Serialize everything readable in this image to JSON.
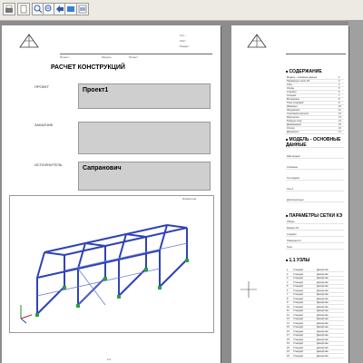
{
  "toolbar": {
    "icons": [
      "print-icon",
      "page-setup-icon",
      "zoom-in-icon",
      "zoom-out-icon",
      "navigate-icon",
      "export-icon",
      "settings-icon"
    ]
  },
  "page1": {
    "header_small": [
      "Стр.:",
      "Лист:",
      "Раздел:",
      "Проект:",
      "Модель:"
    ],
    "header_sub": [
      "Проект:",
      "Модель:",
      "Проект"
    ],
    "title": "РАСЧЕТ КОНСТРУКЦИЙ",
    "fields": [
      {
        "label": "ПРОЕКТ",
        "value": "Проект1"
      },
      {
        "label": "ЗАКАЗЧИК",
        "value": ""
      },
      {
        "label": "ИСПОЛНИТЕЛЬ",
        "value": "Сапранович"
      }
    ],
    "figure_caption": "Изометрия",
    "page_number": "1/1"
  },
  "page2": {
    "toc_title": "СОДЕРЖАНИЕ",
    "model_title": "МОДЕЛЬ - ОСНОВНЫЕ ДАННЫЕ",
    "mesh_title": "ПАРАМЕТРЫ СЕТКИ КЭ",
    "nodes_title": "1.1 УЗЛЫ",
    "toc_items": [
      "Модель - основные данные",
      "Параметры сетки КЭ",
      "Узлы",
      "Опоры",
      "Стержни",
      "Сечения",
      "Материалы",
      "Типы стержней",
      "Шарниры",
      "Загружения",
      "Сочетания нагрузок",
      "Результаты",
      "Реакции опор",
      "Деформации",
      "Усилия",
      "Документы"
    ],
    "model_rows": [
      "Общие",
      "Имя модели",
      "Описание",
      "Тип модели",
      "Ось Z",
      "Дополнительно"
    ],
    "mesh_rows": [
      "Общие",
      "Размер КЭ",
      "Стержни",
      "Поверхности",
      "Тела"
    ],
    "node_rows": [
      "1",
      "2",
      "3",
      "4",
      "5",
      "6",
      "7",
      "8",
      "9",
      "10",
      "11",
      "12",
      "13",
      "14",
      "15",
      "16",
      "17",
      "18",
      "19",
      "20",
      "21",
      "22"
    ],
    "node_type": "Стандарт",
    "node_ref": "Декартова"
  }
}
